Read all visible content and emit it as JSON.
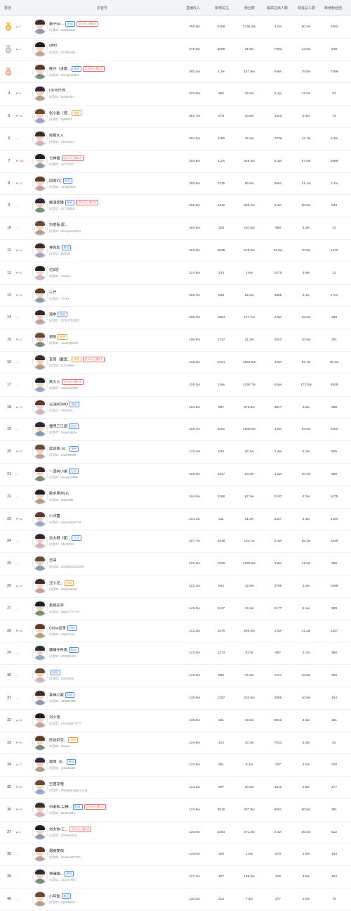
{
  "columns": {
    "rank": "排序",
    "account": "抖音号",
    "estimated_income": "直播收入",
    "new_follows": "新增关注",
    "fans": "粉丝数",
    "peak_online": "最高在线人数",
    "viewers": "观看总人数",
    "new_fans_group": "新增粉丝团"
  },
  "rows": [
    {
      "rank": "1",
      "change": "2",
      "dir": "up",
      "name": "墨子vic...",
      "id": "抖音ID：110814649",
      "tag": "粉丝",
      "hot": "近30天上播5次",
      "v": [
        "785.6w",
        "5258",
        "2746.2w",
        "4.0w",
        "80.2w",
        "2303"
      ]
    },
    {
      "rank": "2",
      "change": "7",
      "dir": "up",
      "name": "ytbbl",
      "id": "抖音ID：577964391",
      "tag": "",
      "hot": "",
      "v": [
        "479.2w",
        "5659",
        "31.8w",
        "7491",
        "13.8w",
        "248"
      ]
    },
    {
      "rank": "3",
      "change": "",
      "dir": "",
      "name": "胜仔（求票...",
      "id": "抖音ID：shengzai0521",
      "tag": "粉丝",
      "hot": "近30天上播3次",
      "v": [
        "393.4w",
        "1.3w",
        "127.9w",
        "9.9w",
        "75.8w",
        "7359"
      ]
    },
    {
      "rank": "4",
      "change": "4",
      "dir": "down",
      "name": "UU可乐伴...",
      "id": "抖音ID：50550397",
      "tag": "",
      "hot": "",
      "v": [
        "373.0w",
        "952",
        "39.2w",
        "1.1w",
        "11.2w",
        "57"
      ]
    },
    {
      "rank": "5",
      "change": "16",
      "dir": "down",
      "name": "张小勤（感...",
      "id": "抖音ID：2y9k623",
      "tag": "偶像",
      "hot": "",
      "v": [
        "361.7w",
        "579",
        "18.8w",
        "2422",
        "5.4w",
        "79"
      ]
    },
    {
      "rank": "6",
      "change": "",
      "dir": "",
      "name": "晓晨大人",
      "id": "抖音ID：31943021",
      "tag": "",
      "hot": "",
      "v": [
        "304.2w",
        "1190",
        "75.2w",
        "7339",
        "12.7w",
        "9.3w"
      ]
    },
    {
      "rank": "7",
      "change": "134",
      "dir": "down",
      "name": "七神祖",
      "id": "抖音ID：qz771123",
      "tag": "",
      "hot": "近30天上播6次",
      "v": [
        "293.9w",
        "1.2w",
        "448.4w",
        "5.3w",
        "87.0w",
        "2969"
      ]
    },
    {
      "rank": "8",
      "change": "12",
      "dir": "down",
      "name": "回游VC",
      "id": "抖音ID：144843529",
      "tag": "粉丝",
      "hot": "",
      "v": [
        "290.8w",
        "2225",
        "56.0w",
        "5661",
        "21.1w",
        "2.4w"
      ]
    },
    {
      "rank": "9",
      "change": "",
      "dir": "",
      "name": "嫩涛笑猪",
      "id": "抖音ID：817396521",
      "tag": "粉丝",
      "hot": "近30天上播1次",
      "v": [
        "268.2w",
        "4442",
        "399.1w",
        "5.4w",
        "90.0w",
        "534"
      ]
    },
    {
      "rank": "10",
      "change": "",
      "dir": "",
      "name": "刘老板.尾...",
      "id": "抖音ID：zhouyinan0221",
      "tag": "",
      "hot": "",
      "v": [
        "260.6w",
        "328",
        "110.8w",
        "989",
        "4.2w",
        "24"
      ]
    },
    {
      "rank": "11",
      "change": "10",
      "dir": "up",
      "name": "林先生",
      "id": "抖音ID：lin0035",
      "tag": "粉丝",
      "hot": "",
      "v": [
        "253.3w",
        "6038",
        "279.9w",
        "12.6w",
        "70.9w",
        "1472"
      ]
    },
    {
      "rank": "12",
      "change": "40",
      "dir": "down",
      "name": "亿&轻",
      "id": "抖音ID：antalun",
      "tag": "",
      "hot": "",
      "v": [
        "224.6w",
        "244",
        "1.6w",
        "1075",
        "4.9w",
        "21"
      ]
    },
    {
      "rank": "13",
      "change": "13",
      "dir": "down",
      "name": "三开",
      "id": "抖音ID：77491",
      "tag": "",
      "hot": "",
      "v": [
        "202.7w",
        "849",
        "62.8w",
        "3995",
        "8.1w",
        "1.7w"
      ]
    },
    {
      "rank": "14",
      "change": "",
      "dir": "",
      "name": "观举",
      "id": "抖音ID：F2307701030",
      "tag": "粉丝",
      "hot": "",
      "v": [
        "200.4w",
        "1854",
        "177.7w",
        "2.8w",
        "32.2w",
        "338"
      ]
    },
    {
      "rank": "15",
      "change": "12",
      "dir": "down",
      "name": "萧郎",
      "id": "抖音ID：xiaolang5200",
      "tag": "偶像",
      "hot": "",
      "v": [
        "196.8w",
        "1717",
        "31.3w",
        "2023",
        "10.9w",
        "201"
      ]
    },
    {
      "rank": "16",
      "change": "",
      "dir": "",
      "name": "言哥（要丢...",
      "id": "抖音ID：DJ239888",
      "tag": "偶像",
      "hot": "近30天上播2次",
      "v": [
        "196.3w",
        "2104",
        "1601.6w",
        "2.8w",
        "52.7w",
        "39.1w"
      ]
    },
    {
      "rank": "17",
      "change": "",
      "dir": "",
      "name": "高大火",
      "id": "抖音ID：Huohuo6666",
      "tag": "",
      "hot": "近30天上播1次",
      "v": [
        "195.3w",
        "1.6w",
        "4158.7w",
        "6.6w",
        "172.0w",
        "6948"
      ]
    },
    {
      "rank": "18",
      "change": "14",
      "dir": "up",
      "name": "以沫MOMO",
      "id": "抖音ID：YMOMO_",
      "tag": "粉丝",
      "hot": "",
      "v": [
        "194.8w",
        "687",
        "375.8w",
        "3517",
        "8.2w",
        "598"
      ]
    },
    {
      "rank": "19",
      "change": "",
      "dir": "",
      "name": "懂哭三江翊",
      "id": "抖音ID：Sanjiangyiyu",
      "tag": "粉丝",
      "hot": "",
      "v": [
        "189.1w",
        "5251",
        "1500.9w",
        "3.5w",
        "54.0w",
        "4203"
      ]
    },
    {
      "rank": "20",
      "change": "23",
      "dir": "down",
      "name": "梁凯恩-日...",
      "id": "抖音ID：LK8888888",
      "tag": "新锐",
      "hot": "",
      "v": [
        "173.4w",
        "943",
        "26.1w",
        "1.4w",
        "5.1w",
        "925"
      ]
    },
    {
      "rank": "21",
      "change": "",
      "dir": "",
      "name": "一波向小弟",
      "id": "抖音ID：xiaodao3666",
      "tag": "生活",
      "hot": "",
      "v": [
        "166.5w",
        "2347",
        "93.3w",
        "1.3w",
        "20.4w",
        "699"
      ]
    },
    {
      "rank": "22",
      "change": "",
      "dir": "",
      "name": "歌手吴帅Lin",
      "id": "抖音ID：Wusn888",
      "tag": "",
      "hot": "",
      "v": [
        "164.6w",
        "1168",
        "97.3w",
        "2197",
        "2.2w",
        "1675"
      ]
    },
    {
      "rank": "23",
      "change": "18",
      "dir": "down",
      "name": "小沐童",
      "id": "抖音ID：xiaomuthe0716",
      "tag": "",
      "hot": "",
      "v": [
        "164.1w",
        "311",
        "21.2w",
        "2447",
        "4.4w",
        "1.9w"
      ]
    },
    {
      "rank": "24",
      "change": "",
      "dir": "",
      "name": "洪大根《团...",
      "id": "抖音ID：24226760",
      "tag": "生活",
      "hot": "",
      "v": [
        "157.7w",
        "3418",
        "115.1w",
        "5.3w",
        "55.3w",
        "1546"
      ]
    },
    {
      "rank": "25",
      "change": "",
      "dir": "",
      "name": "恋哥",
      "id": "抖音ID：acefighter031000",
      "tag": "",
      "hot": "",
      "v": [
        "152.3w",
        "1826",
        "1578.9w",
        "3.6w",
        "41.9w",
        "366"
      ]
    },
    {
      "rank": "26",
      "change": "14",
      "dir": "up",
      "name": "汪小兄...",
      "id": "抖音ID：1115344568",
      "tag": "偶像",
      "hot": "",
      "v": [
        "151.1w",
        "642",
        "12.8w",
        "3799",
        "3.3w",
        "1999"
      ]
    },
    {
      "rank": "27",
      "change": "",
      "dir": "",
      "name": "素颜先学",
      "id": "抖音ID：yujian7777777",
      "tag": "",
      "hot": "",
      "v": [
        "145.5w",
        "1127",
        "19.4w",
        "2177",
        "5.1w",
        "589"
      ]
    },
    {
      "rank": "28",
      "change": "14",
      "dir": "down",
      "name": "China伍哥",
      "id": "抖音ID：wuge1128",
      "tag": "粉丝",
      "hot": "",
      "v": [
        "143.3w",
        "1076",
        "295.5w",
        "2.5w",
        "11.2w",
        "1427"
      ]
    },
    {
      "rank": "29",
      "change": "",
      "dir": "",
      "name": "静静无所需",
      "id": "抖音ID：276595190",
      "tag": "粉丝",
      "hot": "",
      "v": [
        "143.0w",
        "1273",
        "8276",
        "967",
        "3.7w",
        "390"
      ]
    },
    {
      "rank": "30",
      "change": "",
      "dir": "",
      "name": "",
      "id": "抖音ID：11833834",
      "tag": "粉丝",
      "hot": "",
      "v": [
        "140.0w",
        "869",
        "37.3w",
        "7117",
        "15.9w",
        "429"
      ]
    },
    {
      "rank": "31",
      "change": "",
      "dir": "",
      "name": "喜神小梨",
      "id": "抖音ID：349994098",
      "tag": "粉丝",
      "hot": "",
      "v": [
        "138.8w",
        "1257",
        "233.6w",
        "3955",
        "10.9w",
        "164"
      ]
    },
    {
      "rank": "32",
      "change": "26",
      "dir": "up",
      "name": "刘小浩",
      "id": "抖音ID：LXH199477777",
      "tag": "",
      "hot": "",
      "v": [
        "138.8w",
        "241",
        "19.5w",
        "8942",
        "4.5w",
        "191"
      ]
    },
    {
      "rank": "33",
      "change": "35",
      "dir": "down",
      "name": "愿站彩圣...",
      "id": "抖音ID：fkaaas",
      "tag": "偶像",
      "hot": "",
      "v": [
        "134.6w",
        "414",
        "43.4w",
        "7021",
        "9.3w",
        "92"
      ]
    },
    {
      "rank": "34",
      "change": "27",
      "dir": "up",
      "name": "超哥（6...",
      "id": "抖音ID：yy5335368",
      "tag": "粉丝",
      "hot": "",
      "v": [
        "132.6w",
        "251",
        "9.1w",
        "327",
        "1.0w",
        "228"
      ]
    },
    {
      "rank": "35",
      "change": "30",
      "dir": "down",
      "name": "王煌龙哩",
      "id": "抖音ID：WanghangQunLong",
      "tag": "",
      "hot": "",
      "v": [
        "124.2w",
        "307",
        "40.3w",
        "1811",
        "2.8w",
        "177"
      ]
    },
    {
      "rank": "36",
      "change": "51",
      "dir": "down",
      "name": "刘老板-尘蝉...",
      "id": "抖音ID：BC303489",
      "tag": "粉丝",
      "hot": "近30天上播1次",
      "v": [
        "123.8w",
        "5816",
        "407.9w",
        "6601",
        "50.9w",
        "291"
      ]
    },
    {
      "rank": "37",
      "change": "6",
      "dir": "up",
      "name": "刘大帅-工...",
      "id": "抖音ID：LDS566218",
      "tag": "",
      "hot": "近30天上播1次",
      "v": [
        "120.0w",
        "3254",
        "471.0w",
        "2.4w",
        "25.6w",
        "512"
      ]
    },
    {
      "rank": "38",
      "change": "",
      "dir": "",
      "name": "烟雨麦田",
      "id": "抖音ID：baoban007700",
      "tag": "",
      "hot": "",
      "v": [
        "119.0w",
        "426",
        "1.9w",
        "570",
        "1.9w",
        "154"
      ]
    },
    {
      "rank": "39",
      "change": "",
      "dir": "",
      "name": "徐瑞端...",
      "id": "抖音ID：212277967",
      "tag": "粉丝",
      "hot": "",
      "v": [
        "117.7w",
        "427",
        "198.3w",
        "315",
        "3.9w",
        "104"
      ]
    },
    {
      "rank": "40",
      "change": "",
      "dir": "",
      "name": "小年饭",
      "id": "抖音ID：Lipay6000",
      "tag": "粉丝",
      "hot": "",
      "v": [
        "116.2w",
        "214",
        "7.4w",
        "377",
        "2.0w",
        "70"
      ]
    }
  ]
}
